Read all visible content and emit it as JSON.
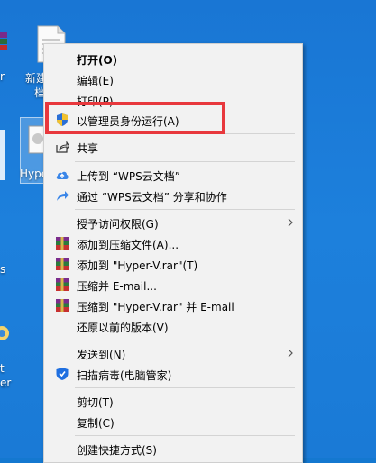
{
  "desktop": {
    "icon_new_label": "新建",
    "icon_new_label2": "档",
    "icon_hyper_label": "Hyper"
  },
  "menu": {
    "items": [
      {
        "label": "打开(O)",
        "icon": "none"
      },
      {
        "label": "编辑(E)",
        "icon": "none"
      },
      {
        "label": "打印(P)",
        "icon": "none"
      },
      {
        "label": "以管理员身份运行(A)",
        "icon": "uac-shield-icon"
      },
      {
        "label": "共享",
        "icon": "share-icon"
      },
      {
        "label": "上传到 “WPS云文档”",
        "icon": "cloud-upload-icon"
      },
      {
        "label": "通过 “WPS云文档” 分享和协作",
        "icon": "share-arrow-icon"
      },
      {
        "label": "授予访问权限(G)",
        "icon": "none",
        "submenu": true
      },
      {
        "label": "添加到压缩文件(A)...",
        "icon": "winrar-icon"
      },
      {
        "label": "添加到 \"Hyper-V.rar\"(T)",
        "icon": "winrar-icon"
      },
      {
        "label": "压缩并 E-mail...",
        "icon": "winrar-icon"
      },
      {
        "label": "压缩到 \"Hyper-V.rar\" 并 E-mail",
        "icon": "winrar-icon"
      },
      {
        "label": "还原以前的版本(V)",
        "icon": "none"
      },
      {
        "label": "发送到(N)",
        "icon": "none",
        "submenu": true
      },
      {
        "label": "扫描病毒(电脑管家)",
        "icon": "pc-manager-shield-icon"
      },
      {
        "label": "剪切(T)",
        "icon": "none"
      },
      {
        "label": "复制(C)",
        "icon": "none"
      },
      {
        "label": "创建快捷方式(S)",
        "icon": "none"
      }
    ]
  },
  "colors": {
    "desktop_bg": "#1478d0",
    "menu_bg": "#f2f2f2",
    "highlight_border": "#e8383d"
  }
}
